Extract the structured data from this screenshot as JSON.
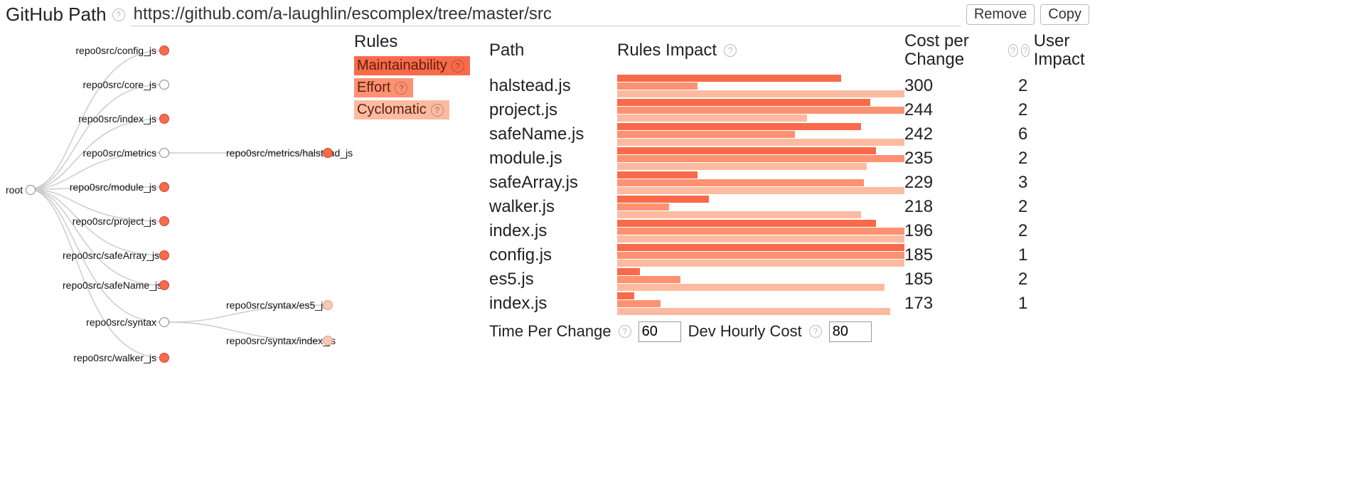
{
  "theme": {
    "maintainability": "#f96a4b",
    "effort": "#fc9272",
    "cyclomatic": "#fcbba1"
  },
  "topbar": {
    "label": "GitHub Path",
    "url": "https://github.com/a-laughlin/escomplex/tree/master/src",
    "remove": "Remove",
    "copy": "Copy"
  },
  "tree": {
    "root_label": "root",
    "nodes": [
      {
        "id": "config",
        "label": "repo0src/config_js",
        "filled": true
      },
      {
        "id": "core",
        "label": "repo0src/core_js",
        "filled": false
      },
      {
        "id": "index",
        "label": "repo0src/index_js",
        "filled": true
      },
      {
        "id": "metrics",
        "label": "repo0src/metrics",
        "filled": false
      },
      {
        "id": "halstead",
        "label": "repo0src/metrics/halstead_js",
        "filled": true
      },
      {
        "id": "module",
        "label": "repo0src/module_js",
        "filled": true
      },
      {
        "id": "project",
        "label": "repo0src/project_js",
        "filled": true
      },
      {
        "id": "safeArray",
        "label": "repo0src/safeArray_js",
        "filled": true
      },
      {
        "id": "safeName",
        "label": "repo0src/safeName_js",
        "filled": true
      },
      {
        "id": "syntax",
        "label": "repo0src/syntax",
        "filled": false
      },
      {
        "id": "es5",
        "label": "repo0src/syntax/es5_js",
        "filled": "faded"
      },
      {
        "id": "sindex",
        "label": "repo0src/syntax/index_js",
        "filled": "faded"
      },
      {
        "id": "walker",
        "label": "repo0src/walker_js",
        "filled": true
      }
    ]
  },
  "rules": {
    "heading": "Rules",
    "items": [
      {
        "label": "Maintainability",
        "color": "#f96a4b"
      },
      {
        "label": "Effort",
        "color": "#fc9272"
      },
      {
        "label": "Cyclomatic",
        "color": "#fcbba1"
      }
    ]
  },
  "headers": {
    "path": "Path",
    "rules_impact": "Rules Impact",
    "cost": "Cost per Change",
    "user": "User Impact"
  },
  "chart_data": {
    "type": "bar",
    "bar_max": 100,
    "series_meta": [
      "maintainability",
      "effort",
      "cyclomatic"
    ],
    "rows": [
      {
        "path": "halstead.js",
        "bars": [
          78,
          28,
          100
        ],
        "cost": 300,
        "user": 2
      },
      {
        "path": "project.js",
        "bars": [
          88,
          100,
          66
        ],
        "cost": 244,
        "user": 2
      },
      {
        "path": "safeName.js",
        "bars": [
          85,
          62,
          100
        ],
        "cost": 242,
        "user": 6
      },
      {
        "path": "module.js",
        "bars": [
          90,
          100,
          87
        ],
        "cost": 235,
        "user": 2
      },
      {
        "path": "safeArray.js",
        "bars": [
          28,
          86,
          100
        ],
        "cost": 229,
        "user": 3
      },
      {
        "path": "walker.js",
        "bars": [
          32,
          18,
          85
        ],
        "cost": 218,
        "user": 2
      },
      {
        "path": "index.js",
        "bars": [
          90,
          100,
          100
        ],
        "cost": 196,
        "user": 2
      },
      {
        "path": "config.js",
        "bars": [
          100,
          100,
          100
        ],
        "cost": 185,
        "user": 1
      },
      {
        "path": "es5.js",
        "bars": [
          8,
          22,
          93
        ],
        "cost": 185,
        "user": 2
      },
      {
        "path": "index.js",
        "bars": [
          6,
          15,
          95
        ],
        "cost": 173,
        "user": 1
      }
    ]
  },
  "inputs": {
    "time_label": "Time Per Change",
    "time_value": "60",
    "cost_label": "Dev Hourly Cost",
    "cost_value": "80"
  }
}
